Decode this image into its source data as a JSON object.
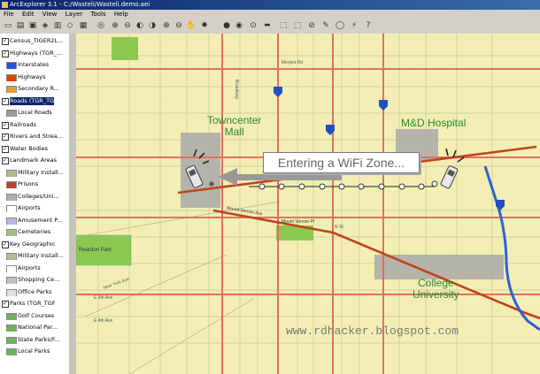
{
  "window": {
    "title": "ArcExplorer 3.1 - C:/Wasteli/Wasteli.demo.aei"
  },
  "menu": [
    "File",
    "Edit",
    "View",
    "Layer",
    "Tools",
    "Help"
  ],
  "toc": {
    "layers": [
      {
        "label": "Census_TIGER2L...",
        "type": "group",
        "color": "#000"
      },
      {
        "label": "Highways (TGR_...",
        "type": "group",
        "color": "#000"
      },
      {
        "label": "Interstates",
        "type": "item",
        "color": "#2a4fd8"
      },
      {
        "label": "Highways",
        "type": "item",
        "color": "#e04010"
      },
      {
        "label": "Secondary R...",
        "type": "item",
        "color": "#e0a030"
      },
      {
        "label": "Roads (TGR_TG",
        "type": "group-selected",
        "color": "#000"
      },
      {
        "label": "Local Roads",
        "type": "item",
        "color": "#999"
      },
      {
        "label": "Railroads",
        "type": "group",
        "color": "#000"
      },
      {
        "label": "Rivers and Strea...",
        "type": "group",
        "color": "#000"
      },
      {
        "label": "Water Bodies",
        "type": "group",
        "color": "#000"
      },
      {
        "label": "Landmark Areas",
        "type": "group",
        "color": "#000"
      },
      {
        "label": "Military Install...",
        "type": "item",
        "color": "#b8b890"
      },
      {
        "label": "Prisons",
        "type": "item",
        "color": "#c04030"
      },
      {
        "label": "Colleges/Uni...",
        "type": "item",
        "color": "#b0b0b0"
      },
      {
        "label": "Airports",
        "type": "item",
        "color": "#ffffff"
      },
      {
        "label": "Amusement P...",
        "type": "item",
        "color": "#b8b8e0"
      },
      {
        "label": "Cemeteries",
        "type": "item",
        "color": "#a0c080"
      },
      {
        "label": "Key Geographic",
        "type": "group",
        "color": "#000"
      },
      {
        "label": "Military Install...",
        "type": "item",
        "color": "#b8b890"
      },
      {
        "label": "Airports",
        "type": "item",
        "color": "#ffffff"
      },
      {
        "label": "Shopping Ce...",
        "type": "item",
        "color": "#c0c0c0"
      },
      {
        "label": "Office Parks",
        "type": "item",
        "color": "#e0e0e0"
      },
      {
        "label": "Parks (TGR_TGF",
        "type": "group",
        "color": "#000"
      },
      {
        "label": "Golf Courses",
        "type": "item",
        "color": "#70b060"
      },
      {
        "label": "National Par...",
        "type": "item",
        "color": "#70b060"
      },
      {
        "label": "State Parks/F...",
        "type": "item",
        "color": "#70b060"
      },
      {
        "label": "Local Parks",
        "type": "item",
        "color": "#70b060"
      }
    ]
  },
  "map": {
    "labels": {
      "towncenter": "Towncenter\nMall",
      "hospital": "M&D Hospital",
      "college": "College\nUniversity",
      "park": "Reardon Park"
    },
    "wifi_message": "Entering a WiFi Zone...",
    "street_labels": [
      "Meyers Rd",
      "Mount Vernon Pl",
      "Mount Vernon Ave",
      "E 6th Ave",
      "E 4th Ave",
      "N St",
      "New York Ave",
      "Broadway"
    ]
  },
  "watermark": "www.rdhacker.blogspot.com",
  "colors": {
    "map_bg": "#f3efb4",
    "road_major": "#e07060",
    "highway": "#c0441c",
    "interstate": "#3060d8",
    "park": "#8cc850",
    "area_gray": "#a9a9a9"
  }
}
